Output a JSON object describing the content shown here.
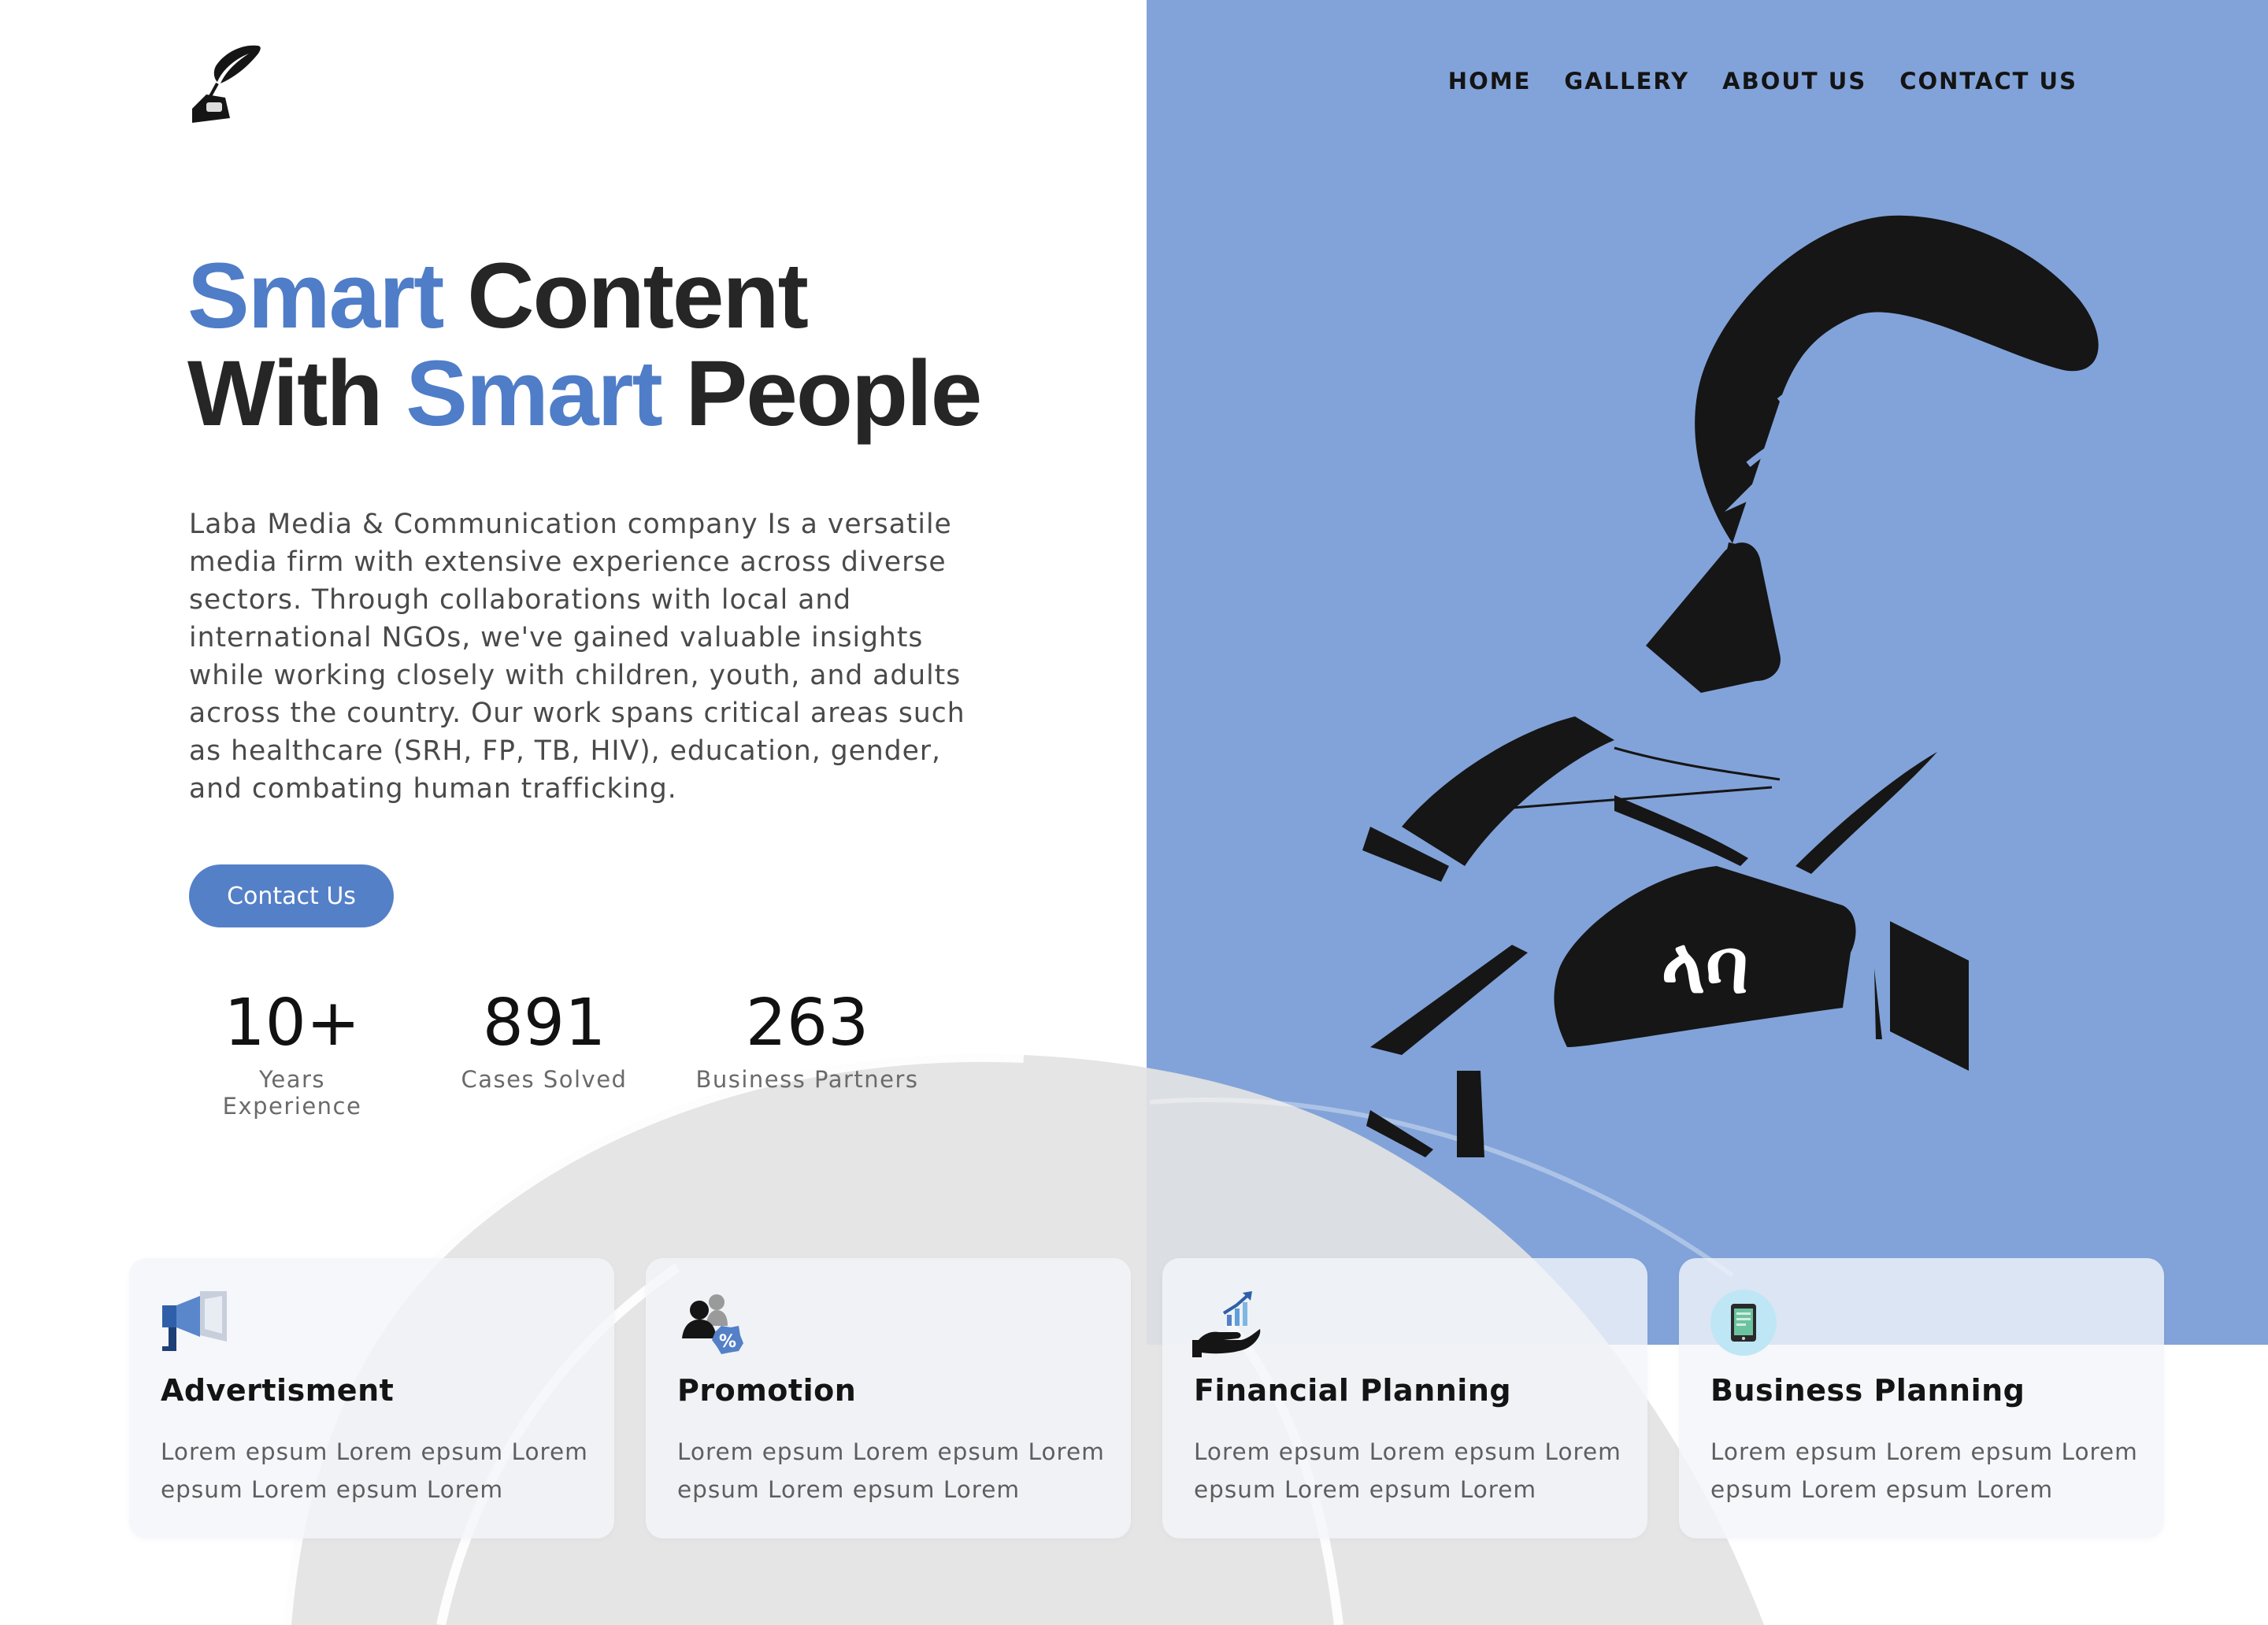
{
  "nav": {
    "items": [
      {
        "label": "HOME"
      },
      {
        "label": "GALLERY"
      },
      {
        "label": "ABOUT US"
      },
      {
        "label": "CONTACT US"
      }
    ]
  },
  "hero": {
    "title_line1_accent": "Smart",
    "title_line1_rest": " Content",
    "title_line2_start": "With ",
    "title_line2_accent": "Smart",
    "title_line2_end": " People",
    "description": "Laba Media & Communication company Is a versatile media firm with extensive experience across diverse sectors. Through collaborations with local and international NGOs, we've gained valuable insights while working closely with children, youth, and adults across the country. Our work spans critical areas such as healthcare (SRH, FP, TB, HIV), education, gender, and combating human trafficking.",
    "cta_label": "Contact Us"
  },
  "stats": [
    {
      "value": "10+",
      "label": "Years Experience"
    },
    {
      "value": "891",
      "label": "Cases Solved"
    },
    {
      "value": "263",
      "label": "Business Partners"
    }
  ],
  "illustration": {
    "badge_text": "ላባ"
  },
  "services": [
    {
      "icon": "megaphone-icon",
      "title": "Advertisment",
      "text": "Lorem epsum Lorem epsum Lorem epsum Lorem epsum Lorem"
    },
    {
      "icon": "promotion-icon",
      "title": "Promotion",
      "text": "Lorem epsum Lorem epsum Lorem epsum Lorem epsum Lorem"
    },
    {
      "icon": "financial-hand-icon",
      "title": "Financial Planning",
      "text": "Lorem epsum Lorem epsum Lorem epsum Lorem epsum Lorem"
    },
    {
      "icon": "tablet-icon",
      "title": "Business Planning",
      "text": "Lorem epsum Lorem epsum Lorem epsum Lorem epsum Lorem"
    }
  ],
  "colors": {
    "accent": "#4f7dc8",
    "panel": "#82a3d9",
    "button": "#5480c8"
  }
}
